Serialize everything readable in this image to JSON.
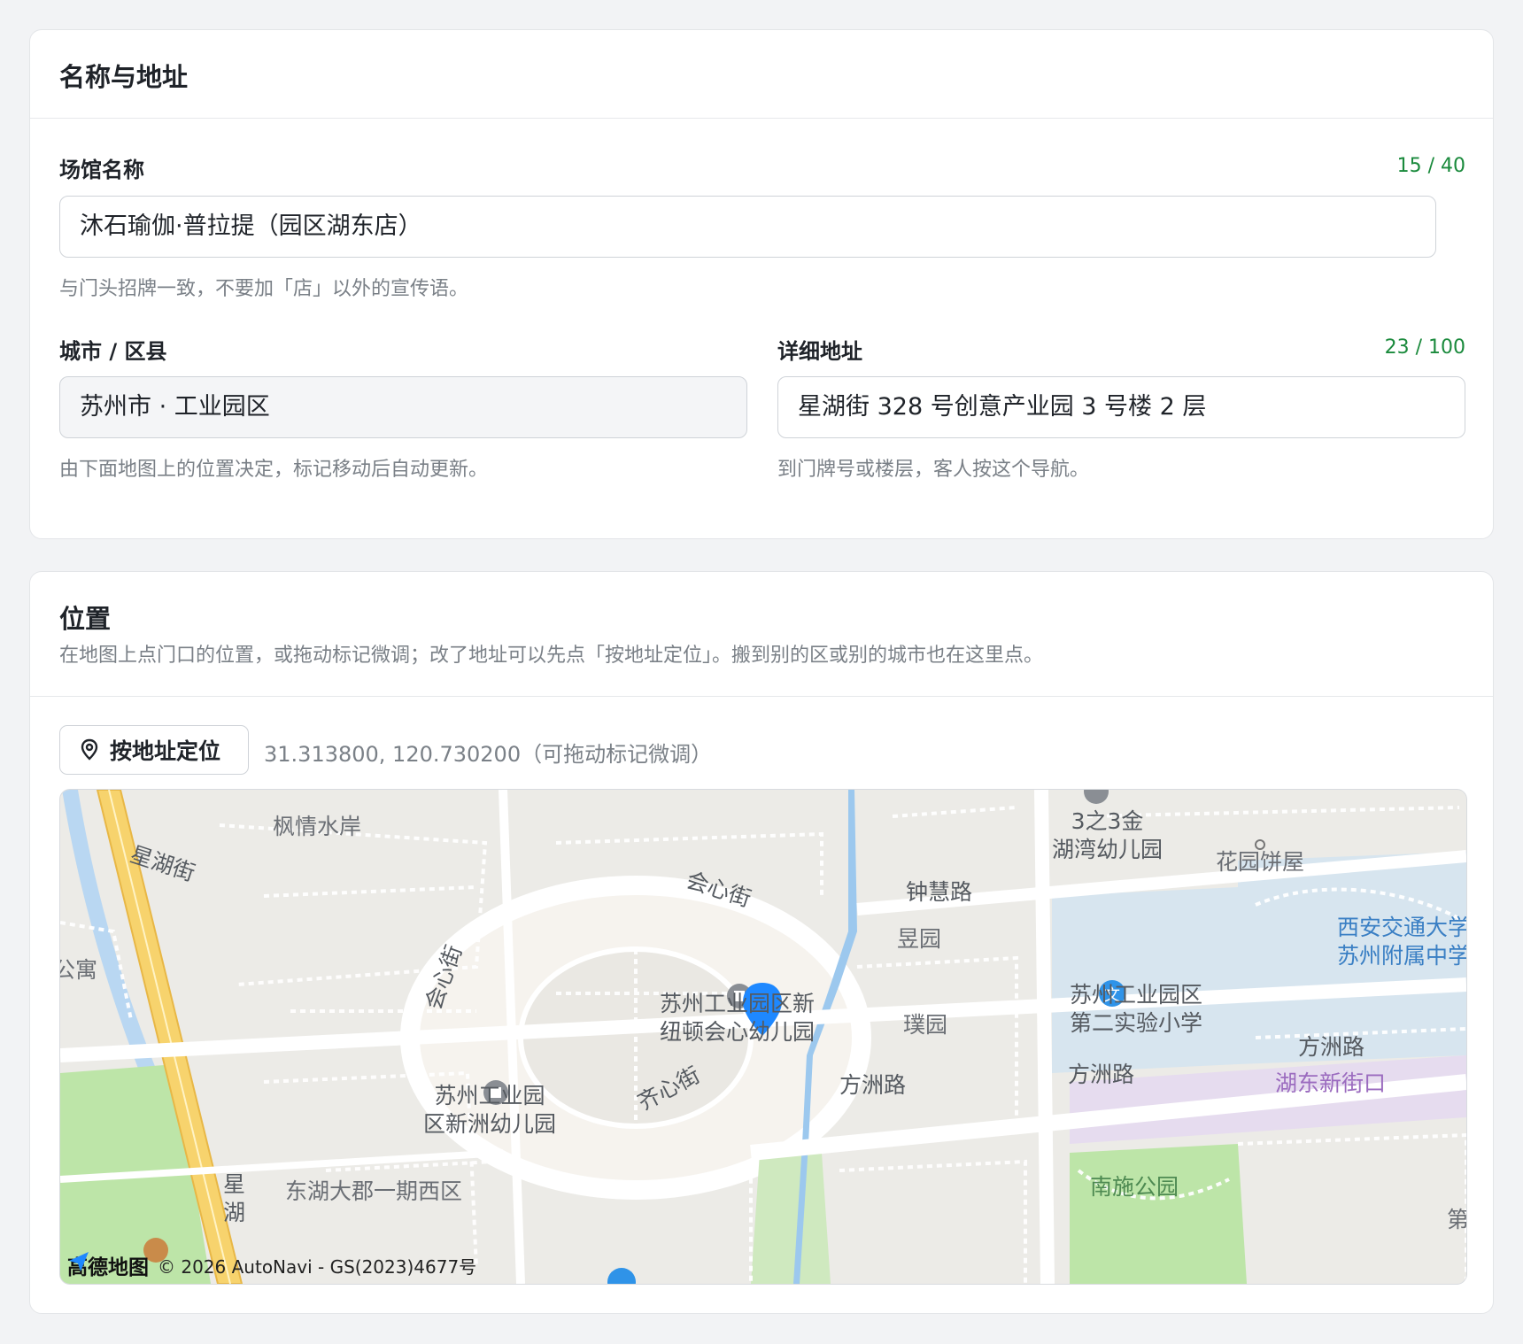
{
  "section_name": {
    "title": "名称与地址",
    "venue_label": "场馆名称",
    "venue_counter": "15 / 40",
    "venue_value": "沐石瑜伽·普拉提（园区湖东店）",
    "venue_hint": "与门头招牌一致，不要加「店」以外的宣传语。",
    "city_label": "城市 / 区县",
    "city_value": "苏州市 · 工业园区",
    "city_hint": "由下面地图上的位置决定，标记移动后自动更新。",
    "address_label": "详细地址",
    "address_counter": "23 / 100",
    "address_value": "星湖街 328 号创意产业园 3 号楼 2 层",
    "address_hint": "到门牌号或楼层，客人按这个导航。"
  },
  "section_location": {
    "title": "位置",
    "description": "在地图上点门口的位置，或拖动标记微调；改了地址可以先点「按地址定位」。搬到别的区或别的城市也在这里点。",
    "locate_button": "按地址定位",
    "locate_icon": "map-pin-icon",
    "coordinates": "31.313800, 120.730200（可拖动标记微调）"
  },
  "map": {
    "labels": {
      "fengqing": "枫情水岸",
      "xinghujie": "星湖街",
      "gongyu": "公寓",
      "huixinjie_top": "会心街",
      "huixinjie_left": "会心街",
      "zhonghuilu": "钟慧路",
      "yuyuan": "昱园",
      "puyuan": "璞园",
      "xinniudun_1": "苏州工业园区新",
      "xinniudun_2": "纽顿会心幼儿园",
      "xinzhou_1": "苏州工业园",
      "xinzhou_2": "区新洲幼儿园",
      "qixinjie": "齐心街",
      "fangzhoulu_1": "方洲路",
      "fangzhoulu_2": "方洲路",
      "fangzhoulu_3": "方洲路",
      "sanzhisan_1": "3之3金",
      "sanzhisan_2": "湖湾幼儿园",
      "huayuan": "花园饼屋",
      "xiaoxue_1": "苏州工业园区",
      "xiaoxue_2": "第二实验小学",
      "xjtu_1": "西安交通大学",
      "xjtu_2": "苏州附属中学",
      "hudong": "湖东新街口",
      "nanshi": "南施公园",
      "donghu": "东湖大郡一期西区",
      "xing2": "星",
      "hu2": "湖",
      "di": "第"
    },
    "brand": "高德地图",
    "copyright": "© 2026 AutoNavi - GS(2023)4677号",
    "marker_color": "#1e88ff"
  }
}
